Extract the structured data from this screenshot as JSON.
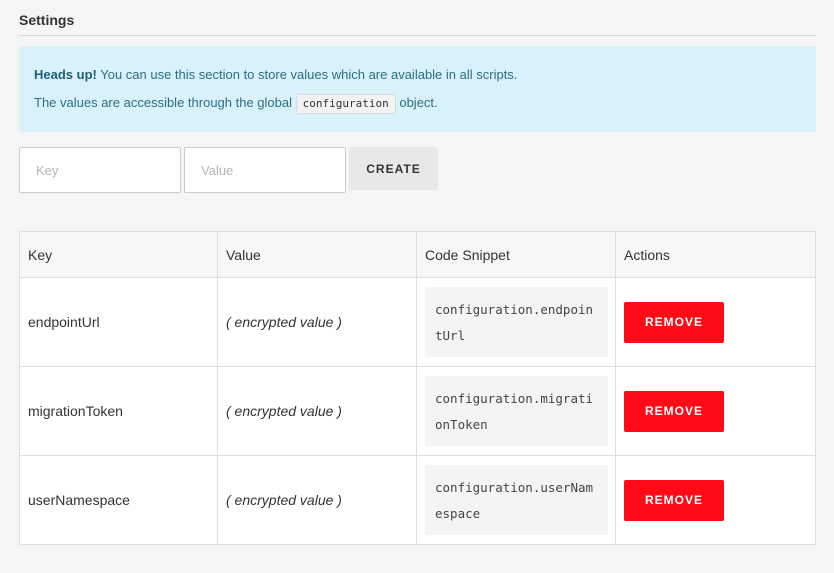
{
  "page": {
    "title": "Settings"
  },
  "alert": {
    "heading": "Heads up!",
    "text": "You can use this section to store values which are available in all scripts.",
    "line2_prefix": "The values are accessible through the global",
    "code": "configuration",
    "line2_suffix": "object."
  },
  "form": {
    "key_placeholder": "Key",
    "value_placeholder": "Value",
    "key_value": "",
    "value_value": "",
    "create_label": "CREATE"
  },
  "table": {
    "headers": [
      "Key",
      "Value",
      "Code Snippet",
      "Actions"
    ],
    "rows": [
      {
        "key": "endpointUrl",
        "value": "( encrypted value )",
        "snippet": "configuration.endpointUrl",
        "action": "REMOVE"
      },
      {
        "key": "migrationToken",
        "value": "( encrypted value )",
        "snippet": "configuration.migrationToken",
        "action": "REMOVE"
      },
      {
        "key": "userNamespace",
        "value": "( encrypted value )",
        "snippet": "configuration.userNamespace",
        "action": "REMOVE"
      }
    ]
  },
  "colors": {
    "alert_bg": "#d9f1fa",
    "alert_text": "#2b6f86",
    "remove_button": "#ff0a16",
    "create_button": "#e8e8e8"
  }
}
